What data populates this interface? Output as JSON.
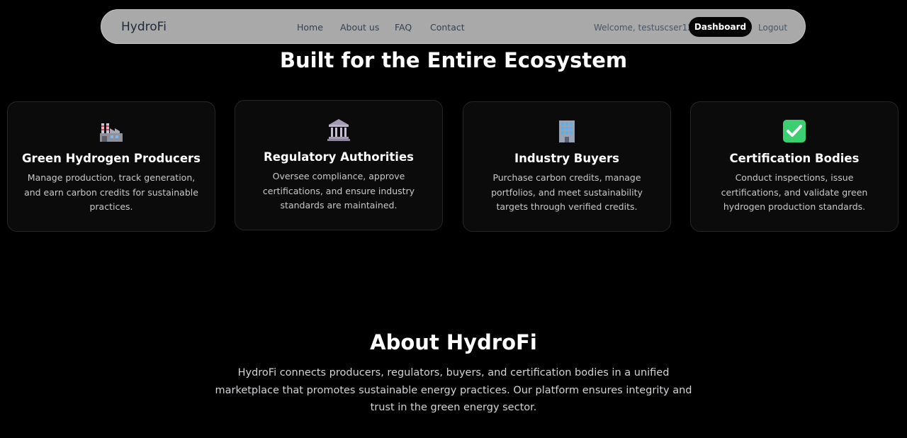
{
  "navbar": {
    "brand": "HydroFi",
    "links": [
      "Home",
      "About us",
      "FAQ",
      "Contact"
    ],
    "welcome": "Welcome, testuscser12!",
    "dashboard_label": "Dashboard",
    "logout_label": "Logout"
  },
  "ecosystem": {
    "title": "Built for the Entire Ecosystem",
    "cards": [
      {
        "icon": "factory-icon",
        "title": "Green Hydrogen Producers",
        "description": "Manage production, track generation, and earn carbon credits for sustainable practices."
      },
      {
        "icon": "classical-building-icon",
        "title": "Regulatory Authorities",
        "description": "Oversee compliance, approve certifications, and ensure industry standards are maintained."
      },
      {
        "icon": "office-building-icon",
        "title": "Industry Buyers",
        "description": "Purchase carbon credits, manage portfolios, and meet sustainability targets through verified credits."
      },
      {
        "icon": "check-mark-icon",
        "title": "Certification Bodies",
        "description": "Conduct inspections, issue certifications, and validate green hydrogen production standards."
      }
    ]
  },
  "about": {
    "title": "About HydroFi",
    "text": "HydroFi connects producers, regulators, buyers, and certification bodies in a unified marketplace that promotes sustainable energy practices. Our platform ensures integrity and trust in the green energy sector."
  },
  "colors": {
    "background": "#000000",
    "navbar": "#a9a9a9",
    "card": "#0b0b0c",
    "check_green": "#3ccf72"
  }
}
